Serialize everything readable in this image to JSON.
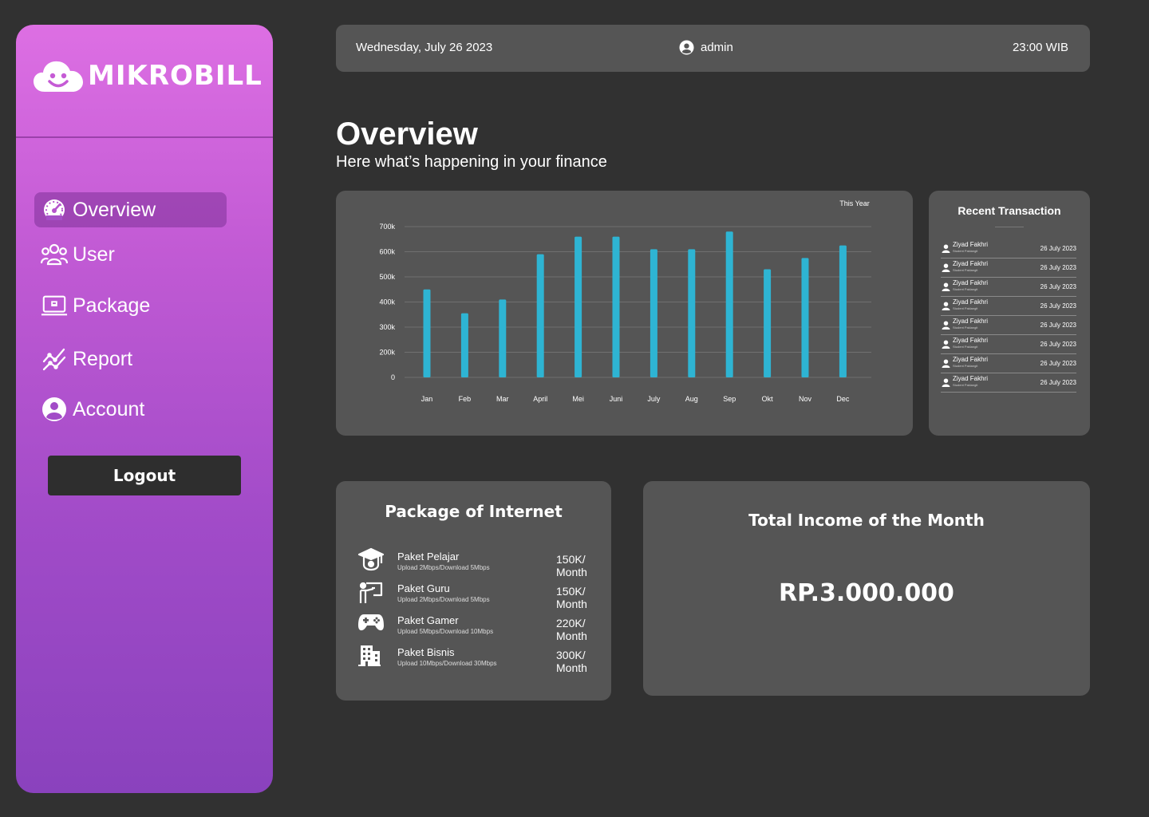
{
  "brand": {
    "name": "MIKROBILL"
  },
  "sidebar": {
    "items": [
      {
        "label": "Overview",
        "icon": "speedometer-icon",
        "active": true
      },
      {
        "label": "User",
        "icon": "users-icon",
        "active": false
      },
      {
        "label": "Package",
        "icon": "package-icon",
        "active": false
      },
      {
        "label": "Report",
        "icon": "chart-line-icon",
        "active": false
      },
      {
        "label": "Account",
        "icon": "account-icon",
        "active": false
      }
    ],
    "logout_label": "Logout"
  },
  "topbar": {
    "date": "Wednesday, July 26 2023",
    "user": "admin",
    "time": "23:00 WIB"
  },
  "header": {
    "title": "Overview",
    "subtitle": "Here what’s happening in your finance"
  },
  "chart_data": {
    "type": "bar",
    "period_label": "This Year",
    "categories": [
      "Jan",
      "Feb",
      "Mar",
      "April",
      "Mei",
      "Juni",
      "July",
      "Aug",
      "Sep",
      "Okt",
      "Nov",
      "Dec"
    ],
    "values": [
      450000,
      355000,
      410000,
      590000,
      660000,
      660000,
      610000,
      610000,
      680000,
      530000,
      575000,
      625000
    ],
    "yticks": [
      0,
      200000,
      300000,
      400000,
      500000,
      600000,
      700000
    ],
    "ytick_labels": [
      "0",
      "200k",
      "300k",
      "400k",
      "500k",
      "600k",
      "700k"
    ],
    "ylim": [
      0,
      700000
    ],
    "grid": true,
    "bar_color": "#2eb4d3"
  },
  "recent": {
    "title": "Recent Transaction",
    "items": [
      {
        "name": "Ziyad Fakhri",
        "sub": "Student Paklangit",
        "date": "26 July 2023"
      },
      {
        "name": "Ziyad Fakhri",
        "sub": "Student Paklangit",
        "date": "26 July 2023"
      },
      {
        "name": "Ziyad Fakhri",
        "sub": "Student Paklangit",
        "date": "26 July 2023"
      },
      {
        "name": "Ziyad Fakhri",
        "sub": "Student Paklangit",
        "date": "26 July 2023"
      },
      {
        "name": "Ziyad Fakhri",
        "sub": "Student Paklangit",
        "date": "26 July 2023"
      },
      {
        "name": "Ziyad Fakhri",
        "sub": "Student Paklangit",
        "date": "26 July 2023"
      },
      {
        "name": "Ziyad Fakhri",
        "sub": "Student Paklangit",
        "date": "26 July 2023"
      },
      {
        "name": "Ziyad Fakhri",
        "sub": "Student Paklangit",
        "date": "26 July 2023"
      }
    ]
  },
  "packages": {
    "title": "Package of Internet",
    "items": [
      {
        "name": "Paket Pelajar",
        "desc": "Upload 2Mbps/Download 5Mbps",
        "price_line1": "150K/",
        "price_line2": "Month",
        "icon": "graduation-cap-icon"
      },
      {
        "name": "Paket Guru",
        "desc": "Upload 2Mbps/Download 5Mbps",
        "price_line1": "150K/",
        "price_line2": "Month",
        "icon": "teacher-icon"
      },
      {
        "name": "Paket Gamer",
        "desc": "Upload 5Mbps/Download 10Mbps",
        "price_line1": "220K/",
        "price_line2": "Month",
        "icon": "gamepad-icon"
      },
      {
        "name": "Paket Bisnis",
        "desc": "Upload 10Mbps/Download 30Mbps",
        "price_line1": "300K/",
        "price_line2": "Month",
        "icon": "building-icon"
      }
    ]
  },
  "income": {
    "title": "Total Income of the Month",
    "value": "RP.3.000.000"
  }
}
